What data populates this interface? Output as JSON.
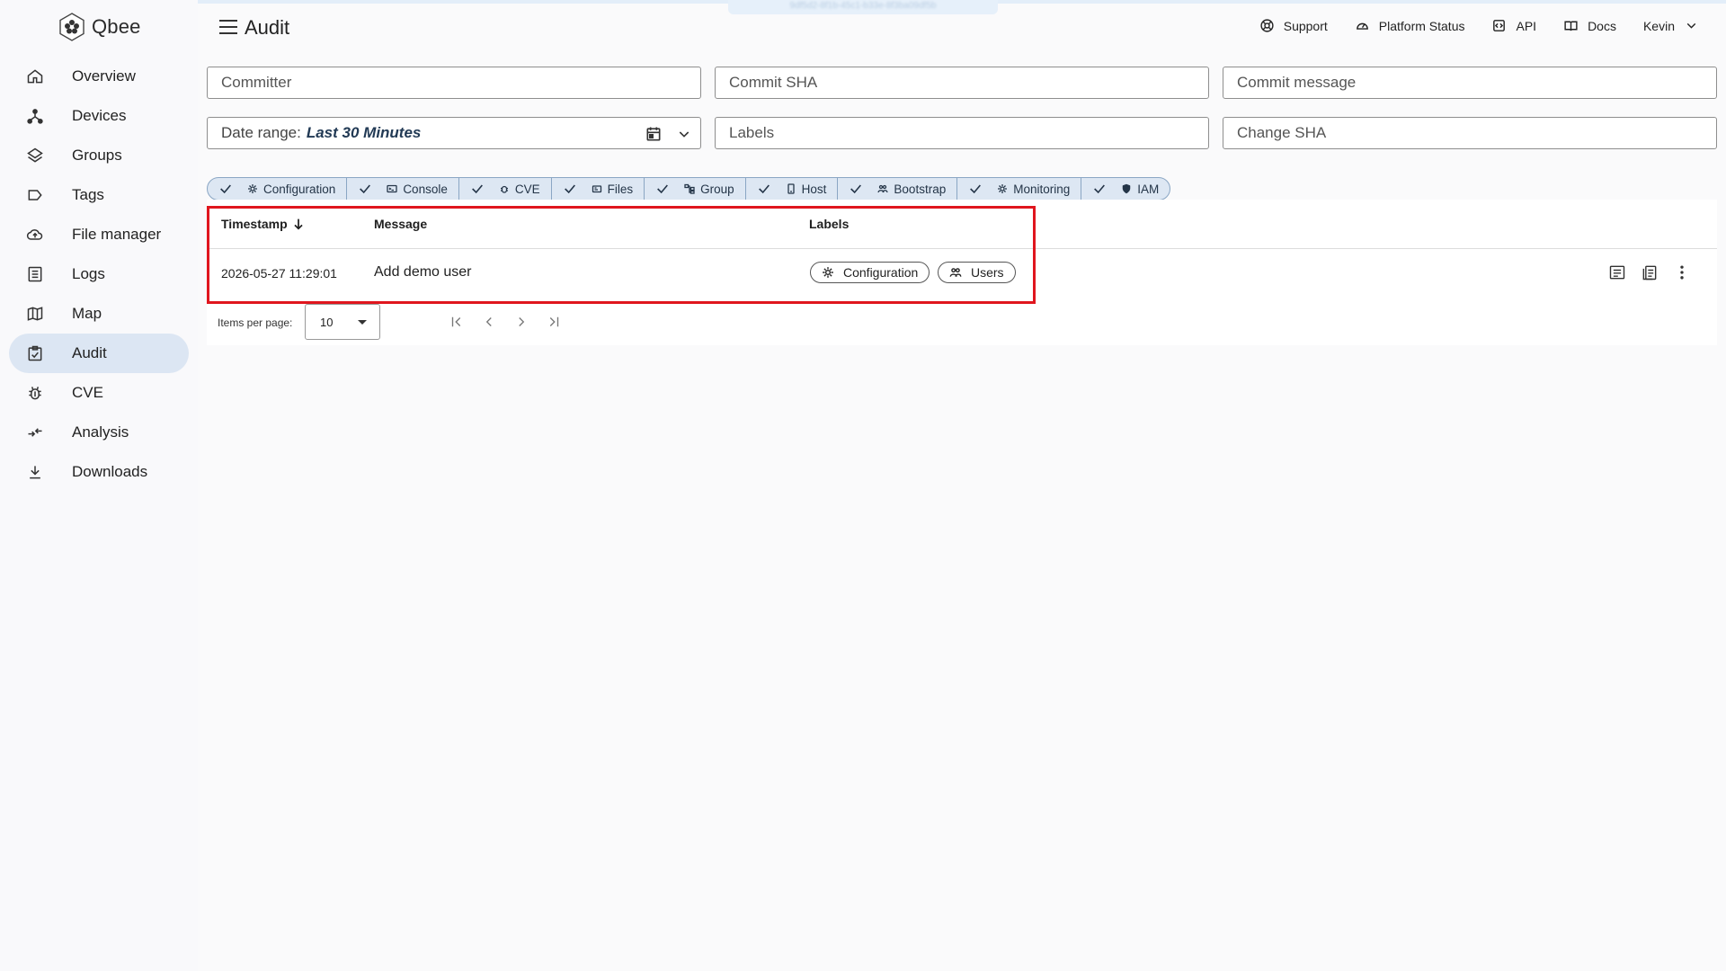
{
  "app": {
    "name": "Qbee"
  },
  "top_badge": "9df5d2-8f1b-45c1-b33e-8f3ba09df5b",
  "sidebar": {
    "items": [
      {
        "label": "Overview",
        "icon": "home-icon",
        "active": false
      },
      {
        "label": "Devices",
        "icon": "devices-icon",
        "active": false
      },
      {
        "label": "Groups",
        "icon": "layers-icon",
        "active": false
      },
      {
        "label": "Tags",
        "icon": "tag-icon",
        "active": false
      },
      {
        "label": "File manager",
        "icon": "cloud-upload-icon",
        "active": false
      },
      {
        "label": "Logs",
        "icon": "logs-icon",
        "active": false
      },
      {
        "label": "Map",
        "icon": "map-icon",
        "active": false
      },
      {
        "label": "Audit",
        "icon": "audit-icon",
        "active": true
      },
      {
        "label": "CVE",
        "icon": "bug-icon",
        "active": false
      },
      {
        "label": "Analysis",
        "icon": "analysis-icon",
        "active": false
      },
      {
        "label": "Downloads",
        "icon": "download-icon",
        "active": false
      }
    ]
  },
  "header": {
    "title": "Audit",
    "links": {
      "support": "Support",
      "platform_status": "Platform Status",
      "api": "API",
      "docs": "Docs",
      "user": "Kevin"
    }
  },
  "filters": {
    "committer": "Committer",
    "commit_sha": "Commit SHA",
    "commit_message": "Commit message",
    "date_range_label": "Date range:",
    "date_range_value": "Last 30 Minutes",
    "labels": "Labels",
    "change_sha": "Change SHA"
  },
  "chips": [
    {
      "label": "Configuration",
      "icon": "gear-icon"
    },
    {
      "label": "Console",
      "icon": "console-icon"
    },
    {
      "label": "CVE",
      "icon": "bug-icon"
    },
    {
      "label": "Files",
      "icon": "files-icon"
    },
    {
      "label": "Group",
      "icon": "group-icon"
    },
    {
      "label": "Host",
      "icon": "host-icon"
    },
    {
      "label": "Bootstrap",
      "icon": "bootstrap-icon"
    },
    {
      "label": "Monitoring",
      "icon": "monitoring-icon"
    },
    {
      "label": "IAM",
      "icon": "shield-icon"
    }
  ],
  "table": {
    "headers": {
      "timestamp": "Timestamp",
      "message": "Message",
      "labels": "Labels"
    },
    "rows": [
      {
        "timestamp": "2026-05-27 11:29:01",
        "message": "Add demo user",
        "labels": [
          "Configuration",
          "Users"
        ]
      }
    ]
  },
  "pagination": {
    "items_per_page_label": "Items per page:",
    "items_per_page": "10"
  },
  "colors": {
    "highlight": "#e0161e",
    "active_nav": "#dce6f3",
    "chip_bg": "#dde7f3"
  }
}
